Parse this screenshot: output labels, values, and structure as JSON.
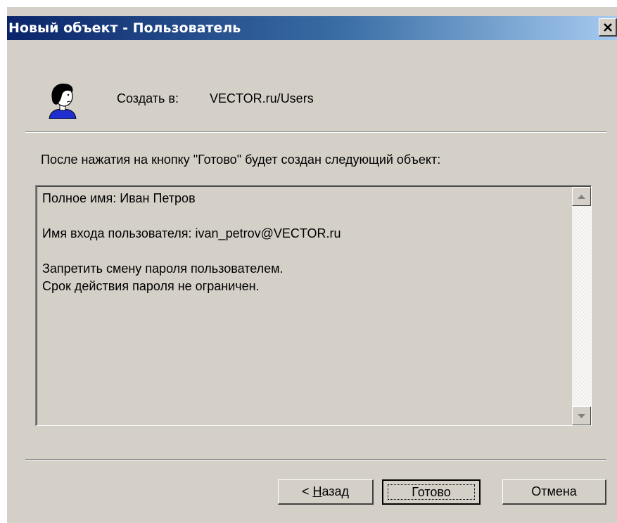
{
  "window": {
    "title": "Новый объект - Пользователь",
    "close_glyph": "✕"
  },
  "header": {
    "icon": "user-icon",
    "create_label": "Создать в:",
    "create_path": "VECTOR.ru/Users"
  },
  "intro_text": "После нажатия на кнопку \"Готово\" будет создан следующий объект:",
  "summary": {
    "lines": [
      "Полное имя: Иван Петров",
      "",
      "Имя входа пользователя: ivan_petrov@VECTOR.ru",
      "",
      "Запретить смену пароля пользователем.",
      "Срок действия пароля не ограничен."
    ]
  },
  "buttons": {
    "back_prefix": "< ",
    "back_mnemonic": "Н",
    "back_rest": "азад",
    "finish": "Готово",
    "cancel": "Отмена"
  },
  "colors": {
    "title_start": "#0a246a",
    "title_end": "#a6caf0",
    "dialog_bg": "#d4d0c8"
  }
}
